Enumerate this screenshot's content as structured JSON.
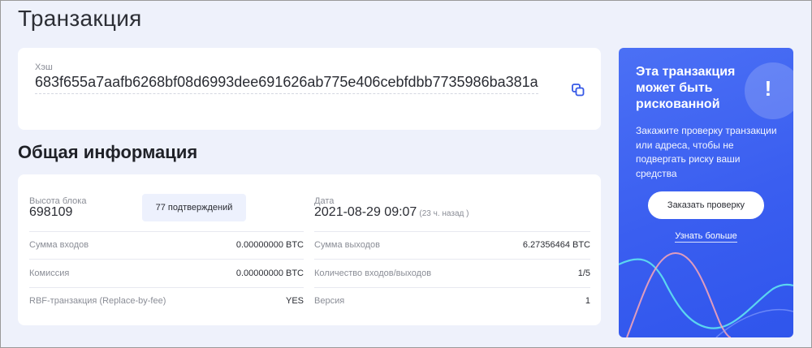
{
  "page": {
    "title": "Транзакция"
  },
  "hash": {
    "label": "Хэш",
    "value": "683f655a7aafb6268bf08d6993dee691626ab775e406cebfdbb7735986ba381a",
    "copy_icon": "copy-icon"
  },
  "general": {
    "title": "Общая информация",
    "block_height_label": "Высота блока",
    "block_height": "698109",
    "confirmations": "77 подтверждений",
    "date_label": "Дата",
    "date": "2021-08-29 09:07",
    "date_ago": "(23 ч. назад )",
    "rows": [
      {
        "left_label": "Сумма входов",
        "left_value": "0.00000000 BTC",
        "right_label": "Сумма выходов",
        "right_value": "6.27356464 BTC"
      },
      {
        "left_label": "Комиссия",
        "left_value": "0.00000000 BTC",
        "right_label": "Количество входов/выходов",
        "right_value": "1/5"
      },
      {
        "left_label": "RBF-транзакция (Replace-by-fee)",
        "left_value": "YES",
        "right_label": "Версия",
        "right_value": "1"
      }
    ]
  },
  "promo": {
    "title": "Эта транзакция может быть рискованной",
    "alert_symbol": "!",
    "text": "Закажите проверку транзакции или адреса, чтобы не подвергать риску ваши средства",
    "button": "Заказать проверку",
    "link": "Узнать больше",
    "colors": {
      "background": "#3a5ef0",
      "wave_pink": "#f2a3b8",
      "wave_cyan": "#5fe3f0"
    }
  }
}
